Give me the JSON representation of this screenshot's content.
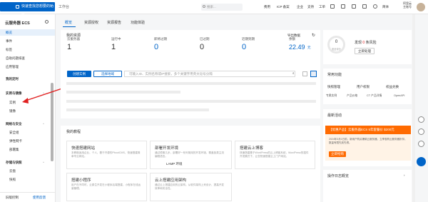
{
  "topbar": {
    "logo": "[-]",
    "tooltip": "快速查找您想要的功能",
    "workbench": "工作台",
    "search_placeholder": "搜索...",
    "nav": [
      "费用",
      "ICP 备案",
      "企业",
      "支持",
      "工单"
    ],
    "user_line1": "阿里云",
    "user_line2": "主账号"
  },
  "sidebar": {
    "title": "云服务器 ECS",
    "items": [
      "概览",
      "事件",
      "标签",
      "自助问题排查",
      "应用管理"
    ],
    "section_plan": "我的定时",
    "group_instances": "实例与镜像",
    "sub_instances": [
      "实例",
      "镜像"
    ],
    "group_network": "网络与安全",
    "sub_network": [
      "安全组",
      "弹性网卡",
      "部署集"
    ],
    "group_storage": "存储与快照",
    "sub_storage": [
      "云盘",
      "快照"
    ],
    "bottom_left": "旧版控制",
    "bottom_right": "使用反馈"
  },
  "tabs": [
    "概览",
    "资源授权",
    "资源报告",
    "功能体验"
  ],
  "resources": {
    "title": "我的资源",
    "export": "导出数据",
    "stats": [
      {
        "label": "云服务器",
        "value": "1"
      },
      {
        "label": "运行中",
        "value": "1"
      },
      {
        "label": "即将过期",
        "value": "0"
      },
      {
        "label": "已过期",
        "value": "0"
      },
      {
        "label": "近期到期",
        "value": "0"
      },
      {
        "label": "余额",
        "value": "22.49"
      }
    ],
    "balance_unit": "元",
    "create_button": "创建实例",
    "region_button": "选择地域",
    "filter_placeholder": "可输入ID、实例名称或IP搜索，多个关键字用英文逗号分隔"
  },
  "quickstart": {
    "title": "我的教程",
    "cards": [
      {
        "title": "快速搭建网站",
        "desc": "本教程适用企业、个人、基于开源的PbootCMS，快速搭建简单专业网站。"
      },
      {
        "title": "部署开发环境",
        "desc": "通过镜像几步，部署好一系列常用的开发环境，覆盖各类主流编程语言。"
      },
      {
        "title": "搭建云上博客",
        "desc": "快速搭建基于WordPress的云上博客系统，WordPress的插件开发模式下，让您快速搭建云上门户网站。"
      },
      {
        "title": "搭建小程序",
        "desc": "用户在不同时，云原生开发在小程序后端搭建，小程序在线运营管理。"
      },
      {
        "title": "云上搭建应用架构",
        "desc": "通过云上搭建应用的云架构，从软件架构上来设计、提高开发效率和安全性。"
      }
    ],
    "lamp": "LAMP 环境"
  },
  "right": {
    "score_value": "0",
    "score_label": "安全评分",
    "risk_prefix": "发现",
    "risk_count": "0",
    "risk_suffix": "条风险",
    "risk_button": "立即处理",
    "features_title": "常用功能",
    "features": [
      "快照管理",
      "用户权限",
      "权益兑换"
    ],
    "features_small": [
      "专属实例",
      "产品价格",
      "CT 产品详情",
      "OpenAPI"
    ],
    "news_title": "最新活动",
    "promo_head": "【优惠产品】云服务器ECS 5年套餐价 $200元",
    "promo_text": "2024年3月1日前，新用户购买爆款云服务器，立享惠购云服务器折扣，数量有限先到先得。",
    "promo_button": "立即抢购",
    "log_title": "操作日志概览"
  }
}
